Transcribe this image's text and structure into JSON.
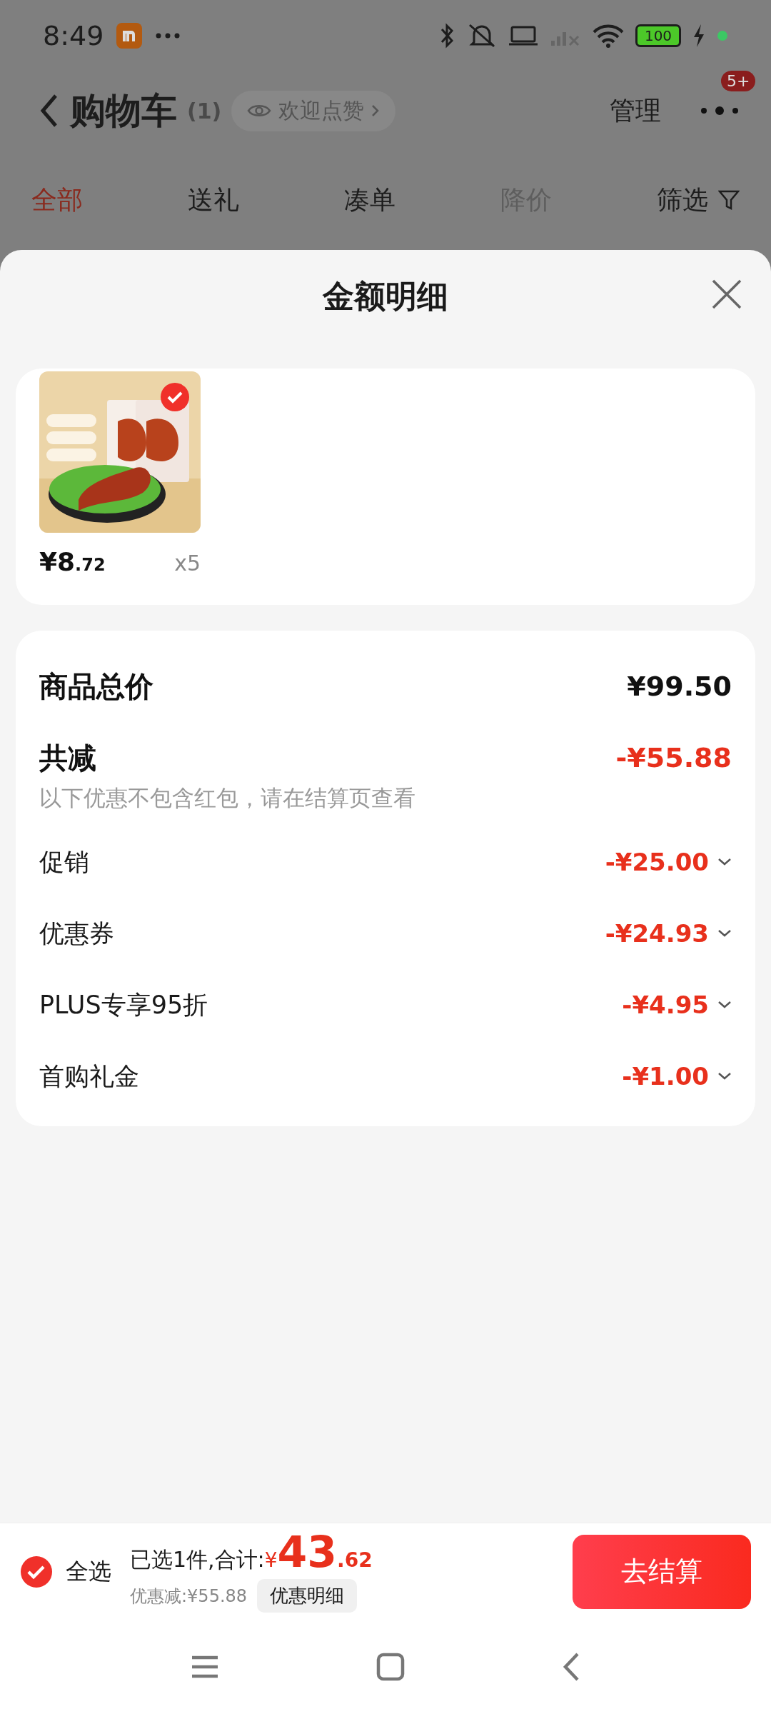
{
  "status_bar": {
    "time": "8:49",
    "battery": "100"
  },
  "header": {
    "title": "购物车",
    "count": "(1)",
    "like_pill": "欢迎点赞",
    "manage": "管理",
    "badge": "5+"
  },
  "tabs": [
    {
      "label": "全部",
      "selected": true,
      "disabled": false
    },
    {
      "label": "送礼",
      "selected": false,
      "disabled": false
    },
    {
      "label": "凑单",
      "selected": false,
      "disabled": false
    },
    {
      "label": "降价",
      "selected": false,
      "disabled": true
    }
  ],
  "filter": "筛选",
  "sheet": {
    "title": "金额明细",
    "items": [
      {
        "kind": "picture",
        "price": "¥8",
        "price_decimal": ".72",
        "quantity": "x5",
        "checked": true
      }
    ],
    "total": {
      "label": "商品总价",
      "value": "¥99.50"
    },
    "reduction": {
      "label": "共减",
      "value": "-¥55.88",
      "note": "以下优惠不包含红包，请在结算页查看"
    },
    "discounts": [
      {
        "label": "促销",
        "value": "-¥25.00"
      },
      {
        "label": "优惠券",
        "value": "-¥24.93"
      },
      {
        "label": "PLUS专享95折",
        "value": "-¥4.95"
      },
      {
        "label": "首购礼金",
        "value": "-¥1.00"
      }
    ]
  },
  "bottom_bar": {
    "select_all": {
      "label": "全选",
      "checked": true
    },
    "selected_text": "已选1件,合计:",
    "currency": "¥",
    "total": "43",
    "total_decimal": ".62",
    "saving": "优惠减:¥55.88",
    "detail_button": "优惠明细",
    "checkout": "去结算"
  }
}
